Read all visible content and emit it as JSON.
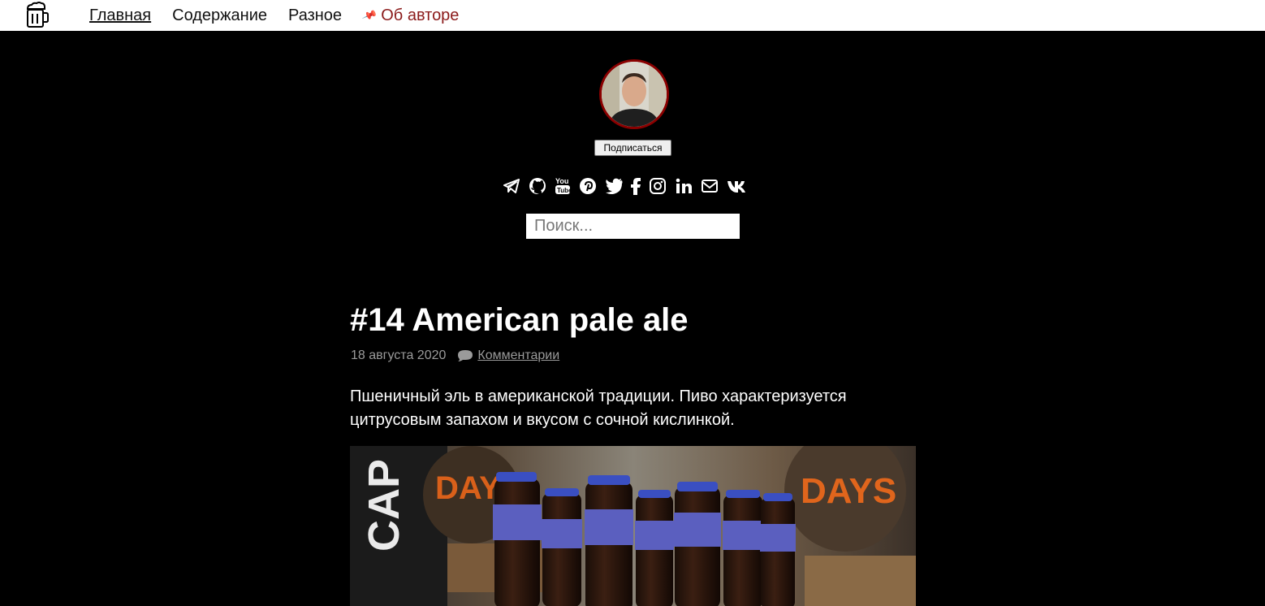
{
  "header": {
    "logo_icon": "beer-mug-icon",
    "nav": [
      {
        "label": "Главная"
      },
      {
        "label": "Содержание"
      },
      {
        "label": "Разное"
      },
      {
        "label": "Об авторе",
        "icon": "pin-icon"
      }
    ]
  },
  "profile": {
    "subscribe_label": "Подписаться",
    "social_icons": [
      "telegram-icon",
      "github-icon",
      "youtube-icon",
      "pinterest-icon",
      "twitter-icon",
      "facebook-icon",
      "instagram-icon",
      "linkedin-icon",
      "mail-icon",
      "vk-icon"
    ]
  },
  "search": {
    "placeholder": "Поиск..."
  },
  "post": {
    "title": "#14 American pale ale",
    "date": "18 августа 2020",
    "comments_label": "Комментарии",
    "excerpt": "Пшеничный эль в американской традиции. Пиво характеризуется цитрусовым запахом и вкусом с сочной кислинкой."
  },
  "colors": {
    "accent": "#8b1a1a",
    "background": "#000000",
    "meta": "#9a9a9a"
  }
}
